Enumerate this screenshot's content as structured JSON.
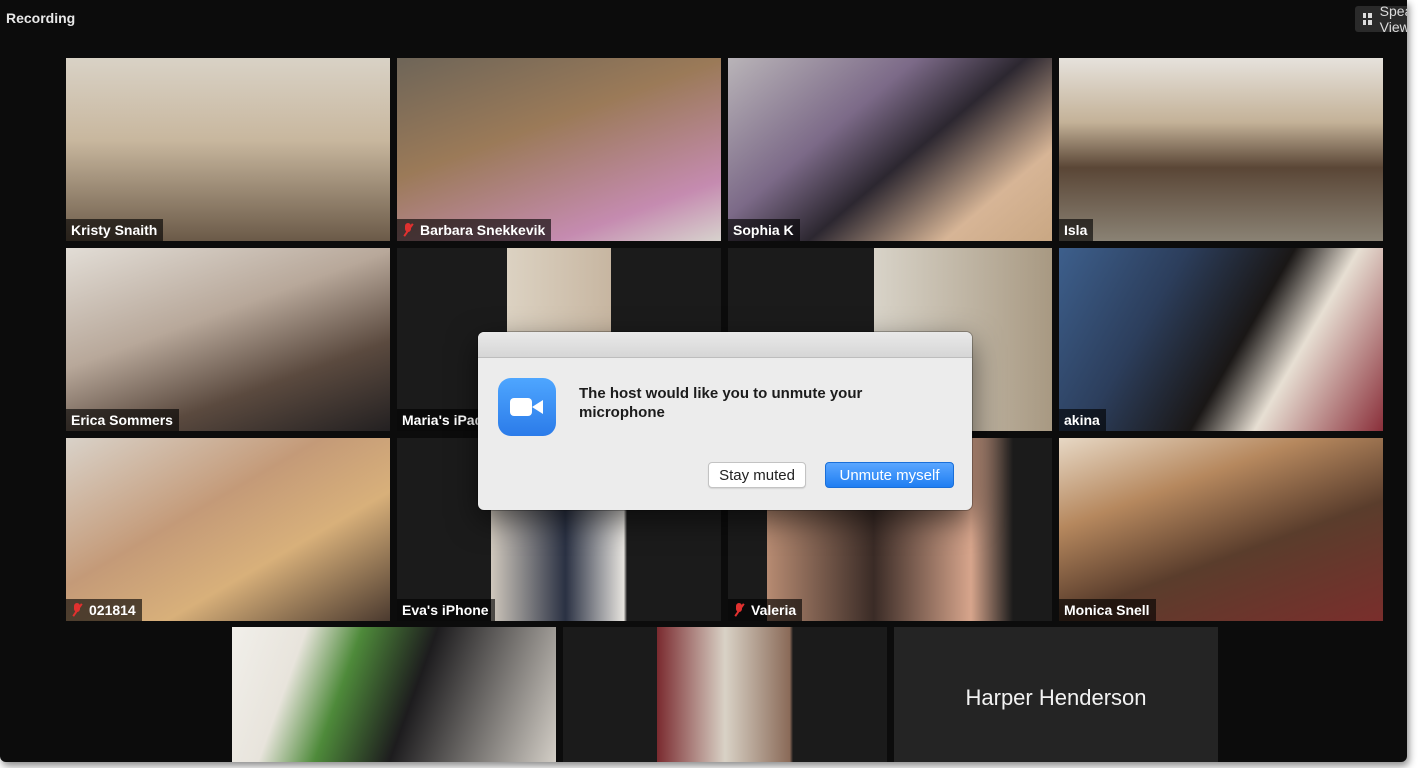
{
  "window": {
    "status_label": "Recording",
    "view_button_label": "Speaker View"
  },
  "participants": [
    {
      "name": "Kristy Snaith",
      "muted": false
    },
    {
      "name": "Barbara Snekkevik",
      "muted": true
    },
    {
      "name": "Sophia K",
      "muted": false
    },
    {
      "name": "Isla",
      "muted": false
    },
    {
      "name": "Erica Sommers",
      "muted": false
    },
    {
      "name": "Maria's iPad",
      "muted": false
    },
    {
      "name": "",
      "muted": false
    },
    {
      "name": "akina",
      "muted": false
    },
    {
      "name": "021814",
      "muted": true
    },
    {
      "name": "Eva's iPhone",
      "muted": false
    },
    {
      "name": "Valeria",
      "muted": true
    },
    {
      "name": "Monica Snell",
      "muted": false
    },
    {
      "name": "",
      "muted": false
    },
    {
      "name": "",
      "muted": false
    },
    {
      "name": "Harper Henderson",
      "muted": false
    }
  ],
  "dialog": {
    "message": "The host would like you to unmute your microphone",
    "stay_muted_label": "Stay muted",
    "unmute_label": "Unmute myself"
  },
  "colors": {
    "active_speaker_border": "#c9d14b",
    "primary_button": "#2b82f4",
    "muted_icon": "#e0312f"
  }
}
